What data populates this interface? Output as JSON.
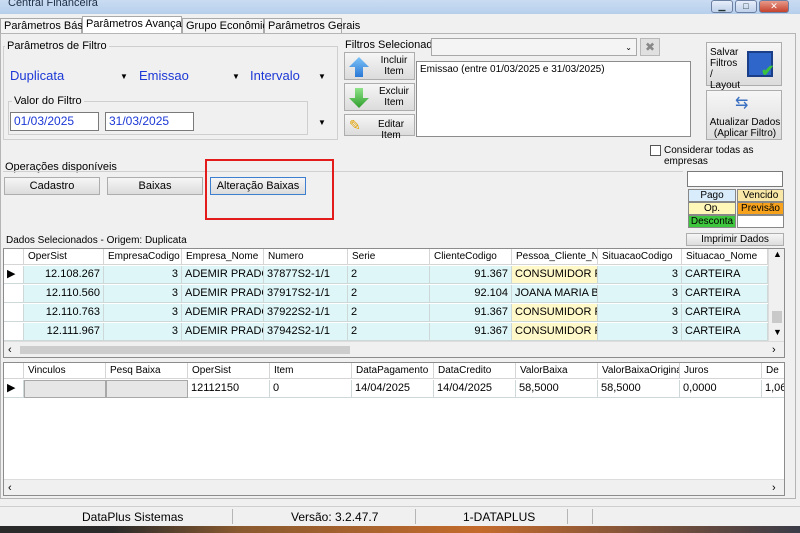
{
  "window": {
    "title": "Central Financeira",
    "buttons": {
      "minimize": "▁",
      "maximize": "□",
      "close": "✕"
    }
  },
  "tabs": [
    {
      "label": "Parâmetros Básicos"
    },
    {
      "label": "Parâmetros Avançados"
    },
    {
      "label": "Grupo Econômico"
    },
    {
      "label": "Parâmetros Gerais"
    }
  ],
  "filters": {
    "group_label": "Parâmetros de Filtro",
    "document_type": "Duplicata",
    "date_field": "Emissao",
    "period_mode": "Intervalo",
    "value_group_label": "Valor do Filtro",
    "date_from": "01/03/2025",
    "date_to": "31/03/2025"
  },
  "selected_filters": {
    "label": "Filtros Selecionados",
    "combo_value": "",
    "list": [
      "Emissao (entre 01/03/2025 e 31/03/2025)"
    ],
    "include_label": "Incluir Item",
    "exclude_label": "Excluir Item",
    "edit_label": "Editar Item"
  },
  "actions": {
    "save_layout": "Salvar Filtros / Layout",
    "refresh": "Atualizar Dados (Aplicar Filtro)",
    "consider_all": "Considerar todas as empresas",
    "consider_all_checked": false
  },
  "operations": {
    "label": "Operações disponíveis",
    "buttons": [
      "Cadastro",
      "Baixas",
      "Alteração Baixas"
    ]
  },
  "legend": {
    "search_value": "",
    "items": [
      {
        "label": "Pago",
        "color": "#d9ecfb"
      },
      {
        "label": "Vencido",
        "color": "#f8e7a6"
      },
      {
        "label": "Op.",
        "color": "#fff7b8"
      },
      {
        "label": "Previsão",
        "color": "#f6a21d"
      },
      {
        "label": "Desconta",
        "color": "#3ec63e"
      }
    ],
    "print_label": "Imprimir Dados"
  },
  "main_grid": {
    "caption": "Dados Selecionados - Origem: Duplicata",
    "columns": [
      "OperSist",
      "EmpresaCodigo",
      "Empresa_Nome",
      "Numero",
      "Serie",
      "ClienteCodigo",
      "Pessoa_Cliente_Nc",
      "SituacaoCodigo",
      "Situacao_Nome"
    ],
    "rows": [
      [
        "12.108.267",
        "3",
        "ADEMIR PRADO...",
        "37877S2-1/1",
        "2",
        "91.367",
        "CONSUMIDOR F...",
        "3",
        "CARTEIRA"
      ],
      [
        "12.110.560",
        "3",
        "ADEMIR PRADO...",
        "37917S2-1/1",
        "2",
        "92.104",
        "JOANA MARIA B...",
        "3",
        "CARTEIRA"
      ],
      [
        "12.110.763",
        "3",
        "ADEMIR PRADO...",
        "37922S2-1/1",
        "2",
        "91.367",
        "CONSUMIDOR F...",
        "3",
        "CARTEIRA"
      ],
      [
        "12.111.967",
        "3",
        "ADEMIR PRADO...",
        "37942S2-1/1",
        "2",
        "91.367",
        "CONSUMIDOR F...",
        "3",
        "CARTEIRA"
      ]
    ]
  },
  "detail_grid": {
    "columns": [
      "Vinculos",
      "Pesq Baixa",
      "OperSist",
      "Item",
      "DataPagamento",
      "DataCredito",
      "ValorBaixa",
      "ValorBaixaOriginal",
      "Juros",
      "De"
    ],
    "rows": [
      [
        "",
        "",
        "12112150",
        "0",
        "14/04/2025",
        "14/04/2025",
        "58,5000",
        "58,5000",
        "0,0000",
        "1,06"
      ]
    ]
  },
  "status_bar": {
    "company": "DataPlus Sistemas",
    "version": "Versão: 3.2.47.7",
    "user": "1-DATAPLUS"
  },
  "colors": {
    "highlight_box": "#e31b1b",
    "row_band": "#dff6f8",
    "title_bar": "#c9dcf2"
  }
}
